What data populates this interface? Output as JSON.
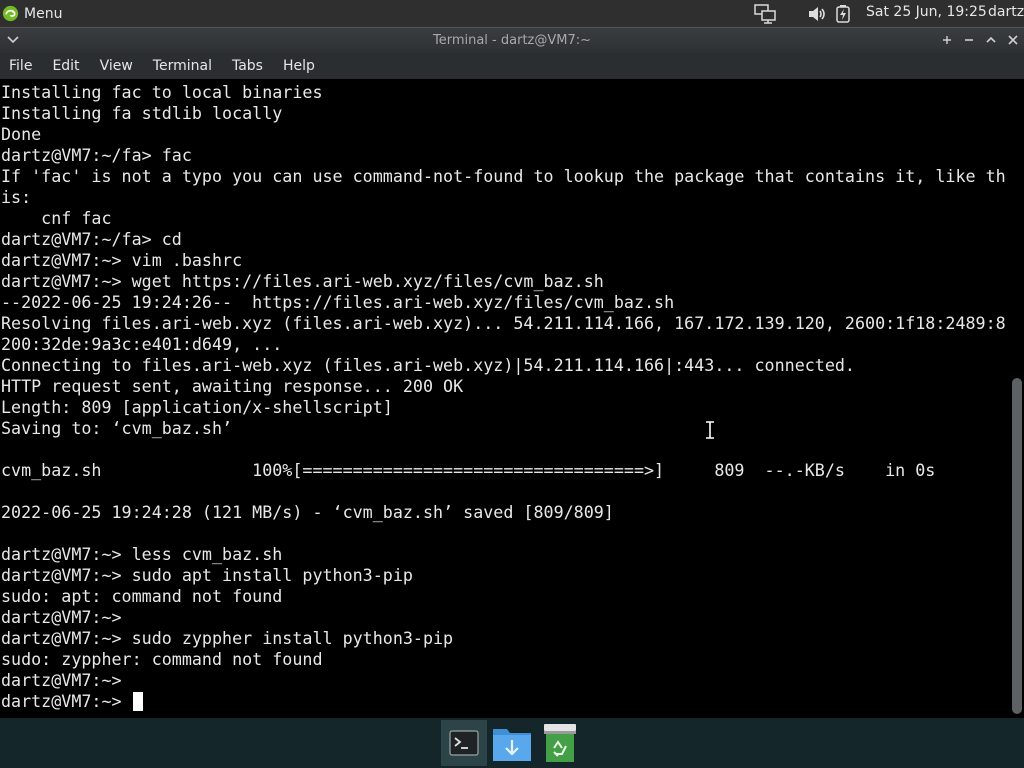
{
  "top_panel": {
    "menu_label": "Menu",
    "clock": "Sat 25 Jun, 19:25",
    "user": "dartz",
    "tray_icons": [
      "network-icon",
      "volume-icon",
      "battery-icon"
    ]
  },
  "window": {
    "title": "Terminal - dartz@VM7:~",
    "controls": [
      "pin-icon",
      "minimize-icon",
      "maximize-icon",
      "close-icon"
    ],
    "menus": [
      "File",
      "Edit",
      "View",
      "Terminal",
      "Tabs",
      "Help"
    ]
  },
  "terminal": {
    "lines": [
      "Installing fac to local binaries",
      "Installing fa stdlib locally",
      "Done",
      "dartz@VM7:~/fa> fac",
      "If 'fac' is not a typo you can use command-not-found to lookup the package that contains it, like th",
      "is:",
      "    cnf fac",
      "dartz@VM7:~/fa> cd",
      "dartz@VM7:~> vim .bashrc",
      "dartz@VM7:~> wget https://files.ari-web.xyz/files/cvm_baz.sh",
      "--2022-06-25 19:24:26--  https://files.ari-web.xyz/files/cvm_baz.sh",
      "Resolving files.ari-web.xyz (files.ari-web.xyz)... 54.211.114.166, 167.172.139.120, 2600:1f18:2489:8",
      "200:32de:9a3c:e401:d649, ...",
      "Connecting to files.ari-web.xyz (files.ari-web.xyz)|54.211.114.166|:443... connected.",
      "HTTP request sent, awaiting response... 200 OK",
      "Length: 809 [application/x-shellscript]",
      "Saving to: ‘cvm_baz.sh’",
      "",
      "cvm_baz.sh               100%[==================================>]     809  --.-KB/s    in 0s",
      "",
      "2022-06-25 19:24:28 (121 MB/s) - ‘cvm_baz.sh’ saved [809/809]",
      "",
      "dartz@VM7:~> less cvm_baz.sh",
      "dartz@VM7:~> sudo apt install python3-pip",
      "sudo: apt: command not found",
      "dartz@VM7:~>",
      "dartz@VM7:~> sudo zyppher install python3-pip",
      "sudo: zyppher: command not found",
      "dartz@VM7:~>"
    ],
    "prompt": "dartz@VM7:~> "
  },
  "taskbar": {
    "items": [
      "terminal-icon",
      "downloads-folder-icon",
      "trash-icon"
    ]
  }
}
